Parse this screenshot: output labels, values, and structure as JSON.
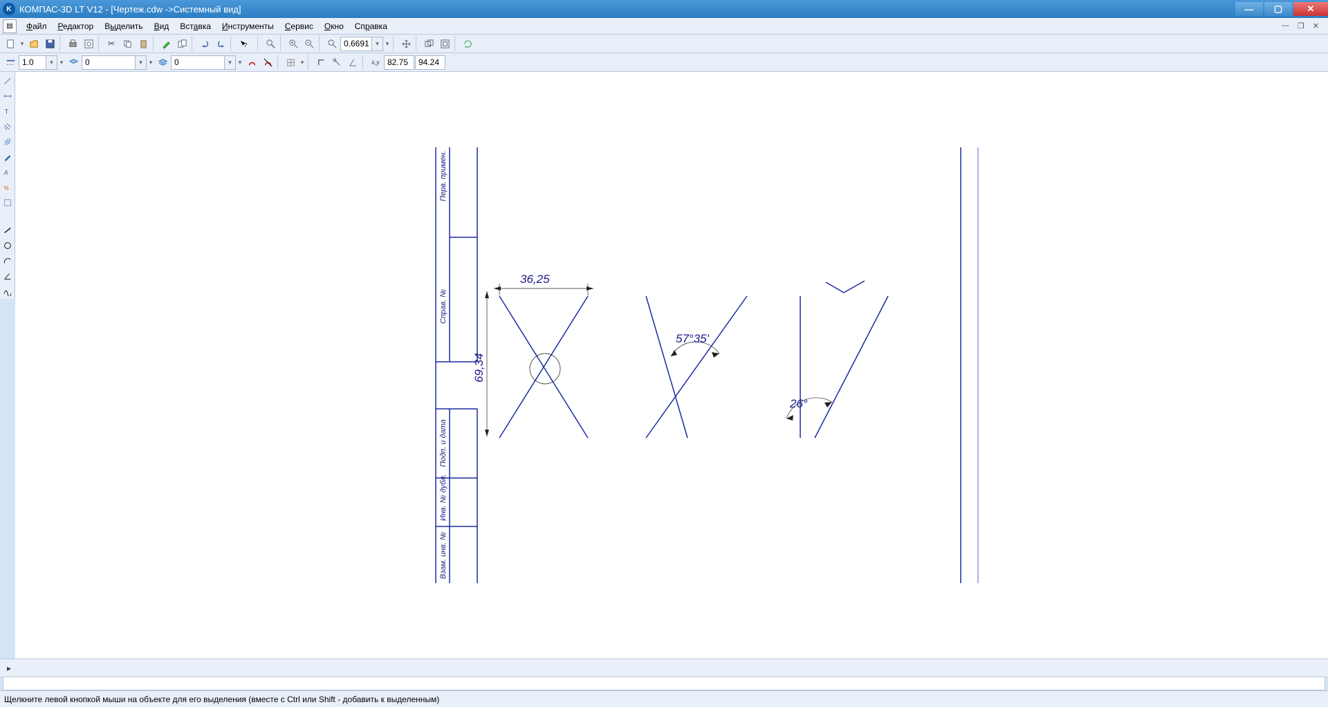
{
  "title": "КОМПАС-3D LT V12 - [Чертеж.cdw ->Системный вид]",
  "menu": {
    "file": "Файл",
    "edit": "Редактор",
    "select": "Выделить",
    "view": "Вид",
    "insert": "Вставка",
    "tools": "Инструменты",
    "service": "Сервис",
    "window": "Окно",
    "help": "Справка"
  },
  "tb": {
    "zoom_value": "0.6691",
    "line_style_value": "1.0",
    "layer1_value": "0",
    "layer2_value": "0",
    "coord_x": "82.75",
    "coord_y": "94.24"
  },
  "drawing": {
    "dim1": "36,25",
    "dim2": "57°35'",
    "dim3": "26°",
    "dim4": "69,34",
    "frame_label1": "Перв. примен.",
    "frame_label2": "Справ. №",
    "frame_label3": "Подп. и дата",
    "frame_label4": "Инв. № дубл.",
    "frame_label5": "Взам. инв. №"
  },
  "status": "Щелкните левой кнопкой мыши на объекте для его выделения (вместе с Ctrl или Shift - добавить к выделенным)"
}
